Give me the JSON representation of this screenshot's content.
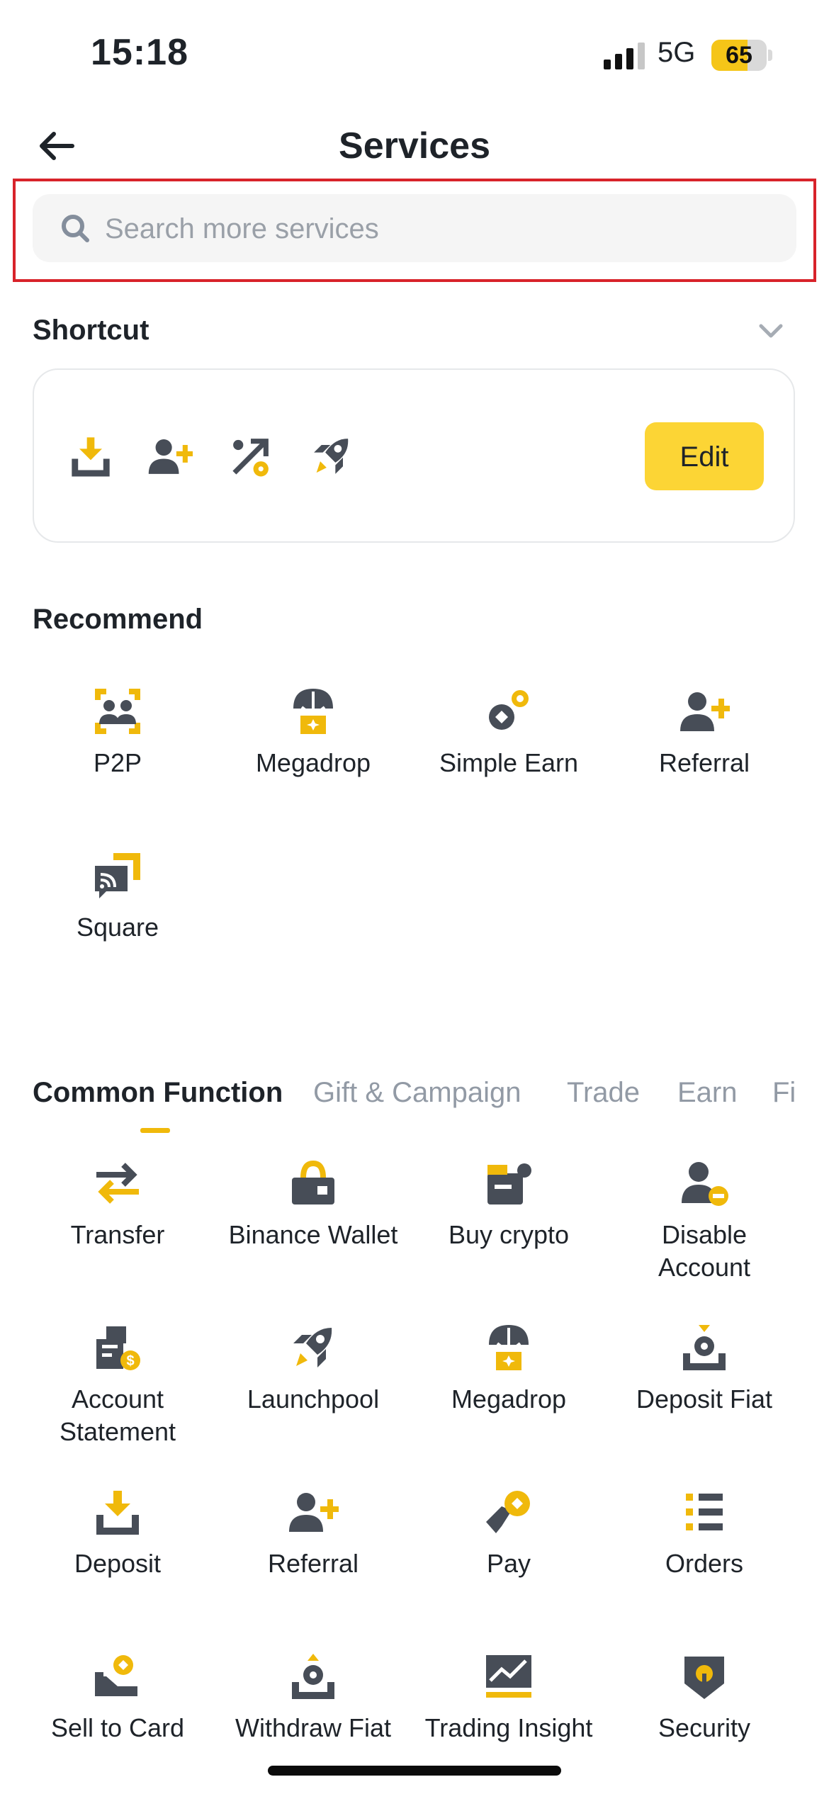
{
  "status_bar": {
    "time": "15:18",
    "network": "5G",
    "battery_level": 65
  },
  "header": {
    "title": "Services",
    "back_icon": "arrow-left-icon"
  },
  "search": {
    "placeholder": "Search more services",
    "value": ""
  },
  "shortcut": {
    "title": "Shortcut",
    "collapse_icon": "chevron-down-icon",
    "icons": [
      "deposit-icon",
      "referral-icon",
      "simple-earn-icon",
      "launchpool-icon"
    ],
    "edit_label": "Edit"
  },
  "recommend": {
    "title": "Recommend",
    "items": [
      {
        "label": "P2P",
        "icon": "p2p-icon"
      },
      {
        "label": "Megadrop",
        "icon": "megadrop-icon"
      },
      {
        "label": "Simple Earn",
        "icon": "simple-earn-icon"
      },
      {
        "label": "Referral",
        "icon": "referral-icon"
      },
      {
        "label": "Square",
        "icon": "square-icon"
      }
    ]
  },
  "tabs": [
    {
      "label": "Common Function",
      "active": true
    },
    {
      "label": "Gift & Campaign",
      "active": false
    },
    {
      "label": "Trade",
      "active": false
    },
    {
      "label": "Earn",
      "active": false
    },
    {
      "label": "Fi",
      "active": false
    }
  ],
  "common": {
    "items": [
      {
        "label": "Transfer",
        "icon": "transfer-icon"
      },
      {
        "label": "Binance Wallet",
        "icon": "wallet-icon"
      },
      {
        "label": "Buy crypto",
        "icon": "buy-crypto-icon"
      },
      {
        "label": "Disable\nAccount",
        "icon": "disable-account-icon"
      },
      {
        "label": "Account\nStatement",
        "icon": "account-statement-icon"
      },
      {
        "label": "Launchpool",
        "icon": "launchpool-icon"
      },
      {
        "label": "Megadrop",
        "icon": "megadrop-icon"
      },
      {
        "label": "Deposit Fiat",
        "icon": "deposit-fiat-icon"
      },
      {
        "label": "Deposit",
        "icon": "deposit-icon"
      },
      {
        "label": "Referral",
        "icon": "referral-icon"
      },
      {
        "label": "Pay",
        "icon": "pay-icon"
      },
      {
        "label": "Orders",
        "icon": "orders-icon"
      },
      {
        "label": "Sell to Card",
        "icon": "sell-to-card-icon"
      },
      {
        "label": "Withdraw Fiat",
        "icon": "withdraw-fiat-icon"
      },
      {
        "label": "Trading Insight",
        "icon": "trading-insight-icon"
      },
      {
        "label": "Security",
        "icon": "security-icon"
      }
    ]
  },
  "colors": {
    "accent": "#FCD535",
    "icon_dark": "#474D57",
    "icon_yellow": "#F0B90B",
    "highlight_box": "#D8232A"
  }
}
